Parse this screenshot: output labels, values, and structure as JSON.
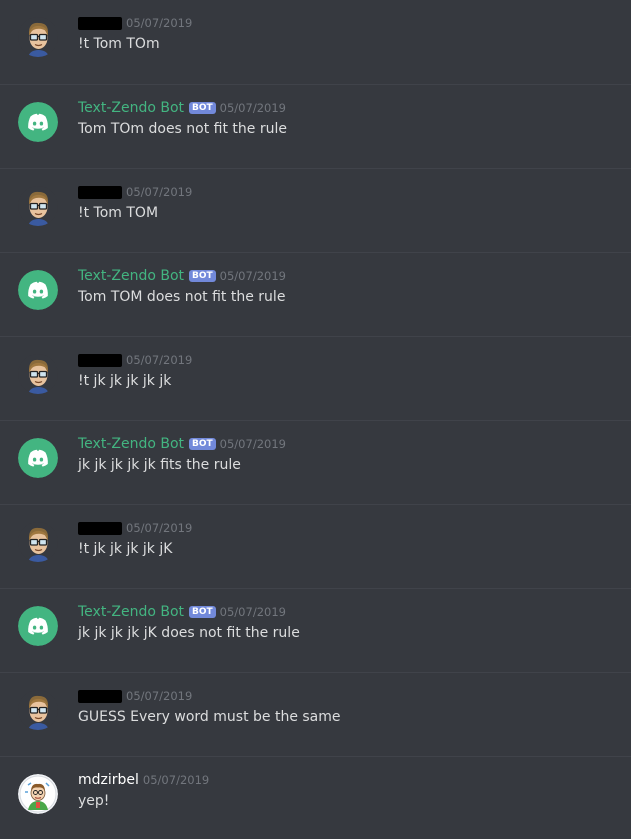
{
  "messages": [
    {
      "author": "",
      "author_type": "human-redacted",
      "avatar": "glasses-avatar",
      "timestamp": "05/07/2019",
      "content": "!t Tom TOm"
    },
    {
      "author": "Text-Zendo Bot",
      "author_type": "bot",
      "badge": "BOT",
      "avatar": "discord-logo-avatar",
      "timestamp": "05/07/2019",
      "content": "Tom TOm does not fit the rule"
    },
    {
      "author": "",
      "author_type": "human-redacted",
      "avatar": "glasses-avatar",
      "timestamp": "05/07/2019",
      "content": "!t Tom TOM"
    },
    {
      "author": "Text-Zendo Bot",
      "author_type": "bot",
      "badge": "BOT",
      "avatar": "discord-logo-avatar",
      "timestamp": "05/07/2019",
      "content": "Tom TOM does not fit the rule"
    },
    {
      "author": "",
      "author_type": "human-redacted",
      "avatar": "glasses-avatar",
      "timestamp": "05/07/2019",
      "content": "!t jk jk jk jk jk"
    },
    {
      "author": "Text-Zendo Bot",
      "author_type": "bot",
      "badge": "BOT",
      "avatar": "discord-logo-avatar",
      "timestamp": "05/07/2019",
      "content": "jk jk jk jk jk fits the rule"
    },
    {
      "author": "",
      "author_type": "human-redacted",
      "avatar": "glasses-avatar",
      "timestamp": "05/07/2019",
      "content": "!t jk jk jk jk jK"
    },
    {
      "author": "Text-Zendo Bot",
      "author_type": "bot",
      "badge": "BOT",
      "avatar": "discord-logo-avatar",
      "timestamp": "05/07/2019",
      "content": "jk jk jk jk jK does not fit the rule"
    },
    {
      "author": "",
      "author_type": "human-redacted",
      "avatar": "glasses-avatar",
      "timestamp": "05/07/2019",
      "content": "GUESS Every word must be the same"
    },
    {
      "author": "mdzirbel",
      "author_type": "human",
      "avatar": "cartoon-avatar",
      "timestamp": "05/07/2019",
      "content": "yep!"
    }
  ],
  "colors": {
    "background": "#36393f",
    "bot_name": "#43b581",
    "bot_badge": "#7289da",
    "discord_avatar": "#43b581",
    "timestamp": "#72767d",
    "text": "#dcddde"
  }
}
